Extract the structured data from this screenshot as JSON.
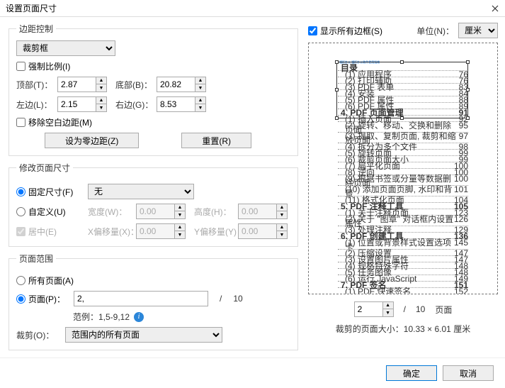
{
  "title": "设置页面尺寸",
  "margin": {
    "legend": "边距控制",
    "cropSelect": "裁剪框",
    "forceRatio": "强制比例(I)",
    "topLabel": "顶部(T)：",
    "topVal": "2.87",
    "bottomLabel": "底部(B)：",
    "bottomVal": "20.82",
    "leftLabel": "左边(L)：",
    "leftVal": "2.15",
    "rightLabel": "右边(G)：",
    "rightVal": "8.53",
    "removeBlank": "移除空白边距(M)",
    "zeroBtn": "设为零边距(Z)",
    "resetBtn": "重置(R)"
  },
  "size": {
    "legend": "修改页面尺寸",
    "fixed": "固定尺寸(F)",
    "fixedSelect": "无",
    "custom": "自定义(U)",
    "widthLabel": "宽度(W)：",
    "widthVal": "0.00",
    "heightLabel": "高度(H)：",
    "heightVal": "0.00",
    "center": "居中(E)",
    "xoffLabel": "X偏移量(X)：",
    "xoffVal": "0.00",
    "yoffLabel": "Y偏移量(Y)：",
    "yoffVal": "0.00"
  },
  "range": {
    "legend": "页面范围",
    "all": "所有页面(A)",
    "page": "页面(P)：",
    "pageVal": "2,",
    "slash": "/",
    "total": "10",
    "exampleLabel": "范例：1,5-9,12",
    "cropLabel": "裁剪(O)：",
    "cropSelect": "范围内的所有页面"
  },
  "rightPane": {
    "showAll": "显示所有边框(S)",
    "unitLabel": "单位(N)：",
    "unitSelect": "厘米",
    "pageSpin": "2",
    "slash": "/",
    "total": "10",
    "pageText": "页面",
    "cropSize": "裁剪的页面大小：10.33 × 6.01 厘米"
  },
  "buttons": {
    "ok": "确定",
    "cancel": "取消"
  }
}
